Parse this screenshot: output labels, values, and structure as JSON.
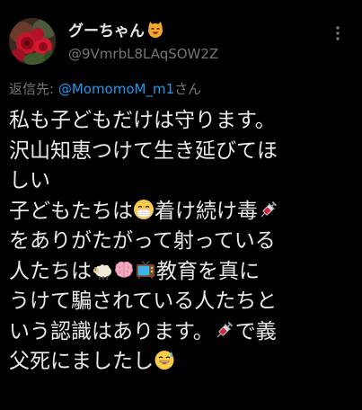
{
  "author": {
    "display_name": "グーちゃん",
    "handle": "@9VmrbL8LAqSOW2Z",
    "name_emoji": "cat-face-emoji"
  },
  "reply": {
    "label": "返信先: ",
    "target": "@MomomoM_m1",
    "suffix": "さん"
  },
  "tweet": {
    "lines": [
      [
        {
          "t": "私も子どもだけは守ります。"
        }
      ],
      [
        {
          "t": "沢山知恵つけて生き延びてほ"
        }
      ],
      [
        {
          "t": "しい"
        }
      ],
      [
        {
          "t": "子どもたちは"
        },
        {
          "e": "mask-face-emoji"
        },
        {
          "t": "着け続け毒"
        },
        {
          "e": "syringe-emoji"
        }
      ],
      [
        {
          "t": "をありがたがって射っている"
        }
      ],
      [
        {
          "t": "人たちは"
        },
        {
          "e": "ram-emoji"
        },
        {
          "e": "brain-emoji"
        },
        {
          "e": "tv-emoji"
        },
        {
          "t": "教育を真に"
        }
      ],
      [
        {
          "t": "うけて騙されている人たちと"
        }
      ],
      [
        {
          "t": "いう認識はあります。"
        },
        {
          "e": "syringe-emoji"
        },
        {
          "t": "で義"
        }
      ],
      [
        {
          "t": "父死にましたし"
        },
        {
          "e": "sweat-smile-emoji"
        }
      ]
    ]
  },
  "colors": {
    "background": "#000000",
    "text": "#e7e9ea",
    "secondary": "#71767b",
    "link": "#1d9bf0"
  }
}
